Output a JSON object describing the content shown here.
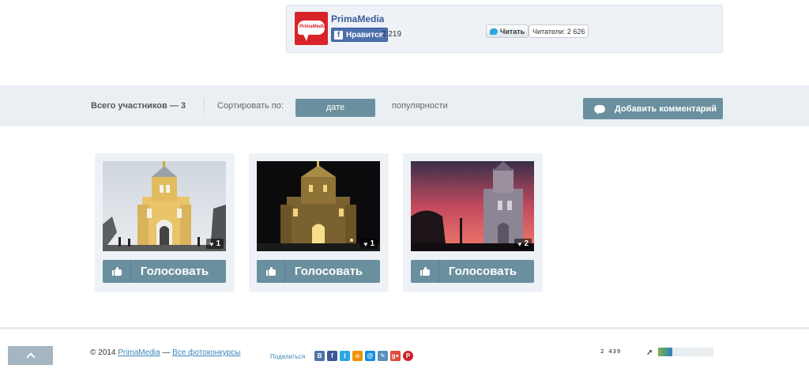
{
  "social": {
    "brand_name": "PrimaMedia",
    "logo_text": "PrimaMedia",
    "fb_like_label": "Нравится",
    "fb_like_count": "2 219",
    "tw_follow_label": "Читать",
    "tw_followers": "Читатели: 2 626"
  },
  "filters": {
    "total_label": "Всего участников — 3",
    "sort_label": "Сортировать по:",
    "sort_date": "дате",
    "sort_popularity": "популярности",
    "add_comment_label": "Добавить комментарий"
  },
  "cards": [
    {
      "likes": "1",
      "vote_label": "Голосовать"
    },
    {
      "likes": "1",
      "vote_label": "Голосовать"
    },
    {
      "likes": "2",
      "vote_label": "Голосовать"
    }
  ],
  "footer": {
    "copyright_prefix": "© 2014",
    "brand_link": "PrimaMedia",
    "separator": "—",
    "all_contests_link": "Все фотоконкурсы",
    "share_label": "Поделиться",
    "share_icons": [
      {
        "name": "vk",
        "glyph": "В",
        "color": "#4c75a3"
      },
      {
        "name": "facebook",
        "glyph": "f",
        "color": "#3b5998"
      },
      {
        "name": "twitter",
        "glyph": "t",
        "color": "#2aa9e0"
      },
      {
        "name": "odnoklassniki",
        "glyph": "о",
        "color": "#f29400"
      },
      {
        "name": "mailru",
        "glyph": "@",
        "color": "#168de2"
      },
      {
        "name": "livejournal",
        "glyph": "✎",
        "color": "#5b8fb8"
      },
      {
        "name": "googleplus",
        "glyph": "g+",
        "color": "#dd4b39"
      },
      {
        "name": "pinterest",
        "glyph": "P",
        "color": "#cb2027"
      }
    ],
    "counter_value": "2 439"
  },
  "colors": {
    "accent": "#6a909f",
    "bar_bg": "#eaeff4",
    "card_bg": "#eef2f6"
  }
}
